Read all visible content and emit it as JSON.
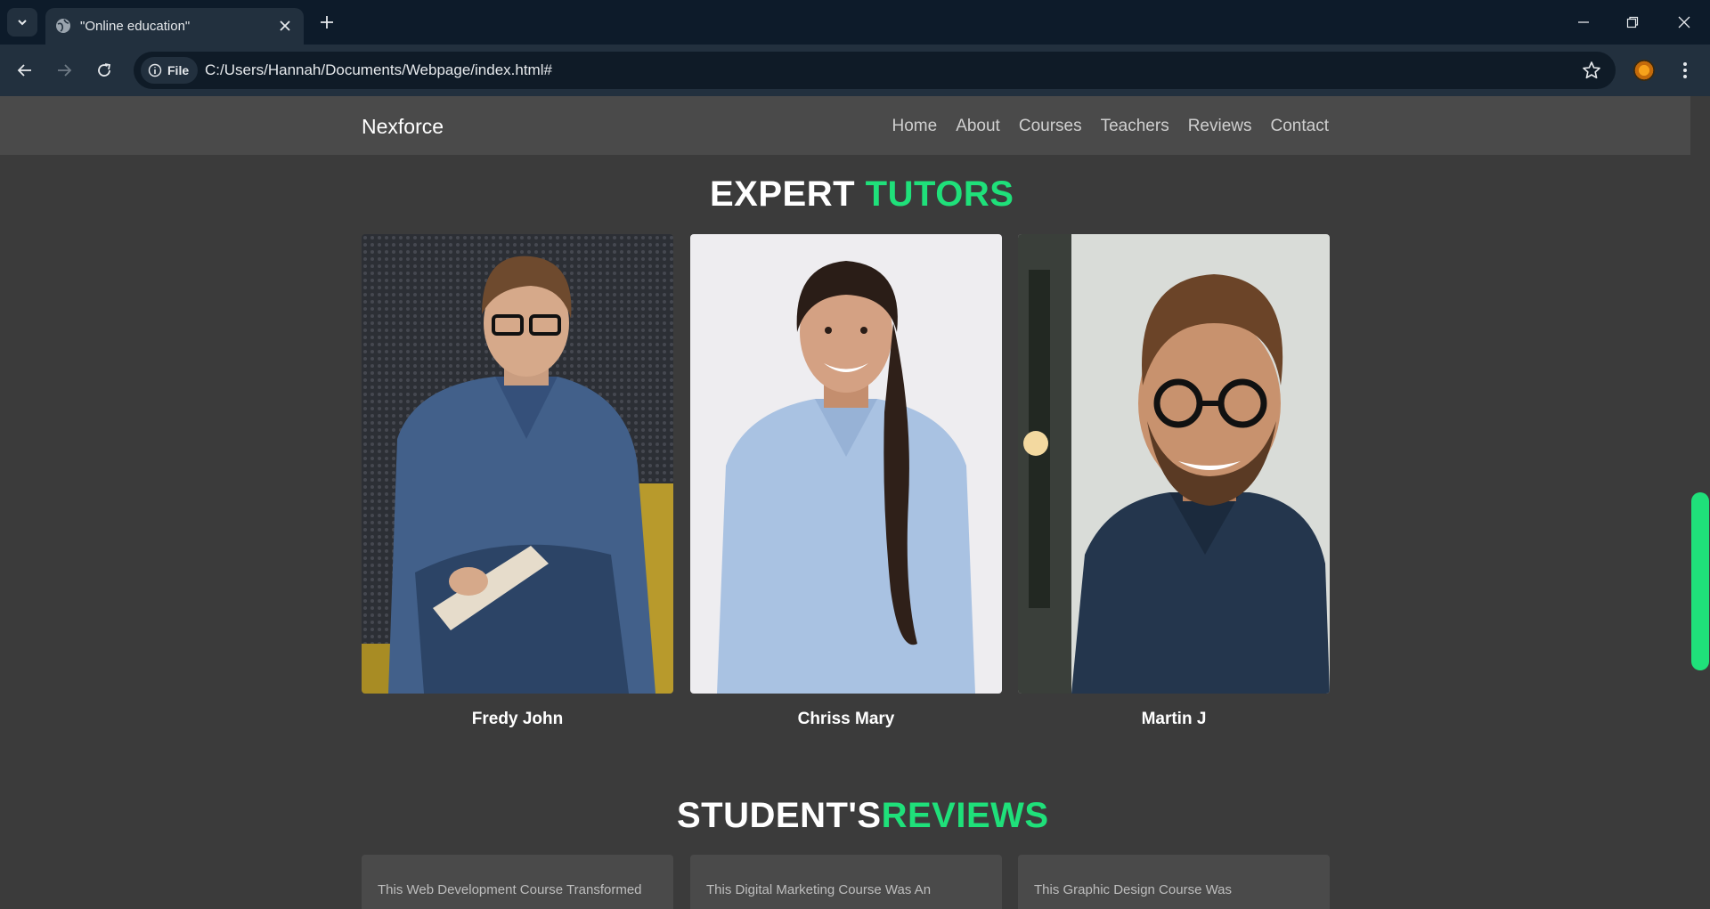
{
  "browser": {
    "tab_title": "\"Online education\"",
    "file_chip": "File",
    "url": "C:/Users/Hannah/Documents/Webpage/index.html#"
  },
  "site": {
    "brand": "Nexforce",
    "nav": [
      "Home",
      "About",
      "Courses",
      "Teachers",
      "Reviews",
      "Contact"
    ]
  },
  "tutors": {
    "title_main": "EXPERT",
    "title_accent": "TUTORS",
    "items": [
      {
        "name": "Fredy John"
      },
      {
        "name": "Chriss Mary"
      },
      {
        "name": "Martin J"
      }
    ]
  },
  "reviews": {
    "title_main": "STUDENT'S",
    "title_accent": "REVIEWS",
    "items": [
      {
        "text": "This Web Development Course Transformed"
      },
      {
        "text": "This Digital Marketing Course Was An"
      },
      {
        "text": "This Graphic Design Course Was"
      }
    ]
  },
  "colors": {
    "accent": "#1fe07a",
    "page_bg": "#3b3b3b",
    "nav_bg": "#4a4a4a",
    "chrome_bg": "#0d1b2a"
  }
}
